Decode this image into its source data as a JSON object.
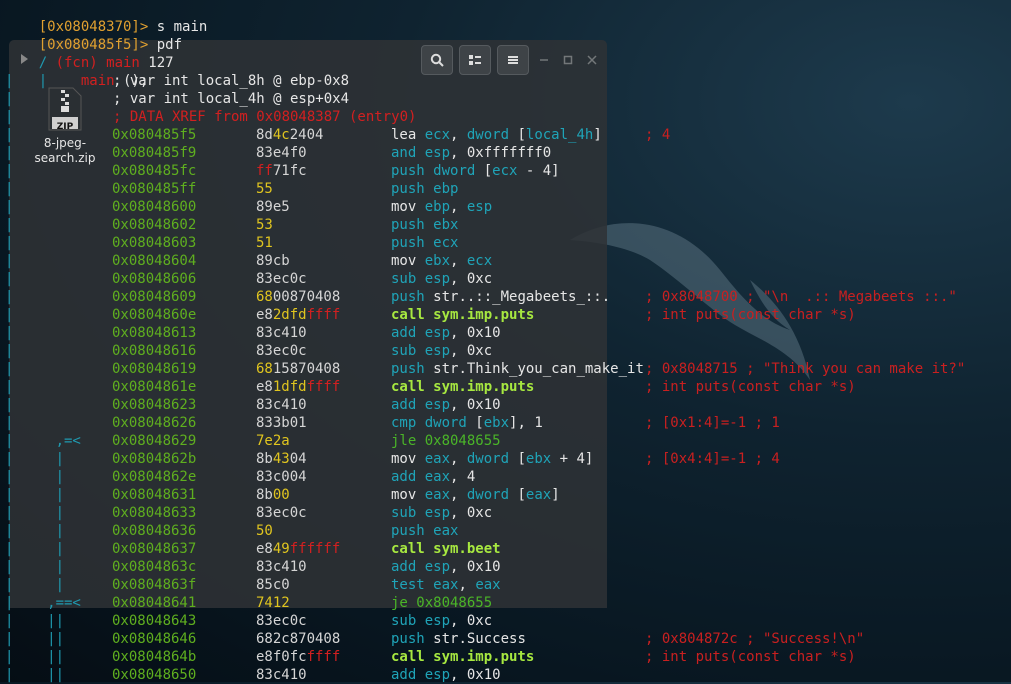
{
  "prompt": [
    {
      "addr": "[0x08048370]>",
      "cmd": " s main"
    },
    {
      "addr": "[0x080485f5]>",
      "cmd": " pdf"
    }
  ],
  "func_header": {
    "prefix": "/ ",
    "fcn": "(fcn) main",
    "size": " 127"
  },
  "func_sig": {
    "name": "main",
    "rest": " ();"
  },
  "vars": [
    "; var int local_8h @ ebp-0x8",
    "; var int local_4h @ esp+0x4"
  ],
  "xref": "; DATA XREF from 0x08048387 (entry0)",
  "desktop_icon": {
    "label_line1": "8-jpeg-",
    "label_line2": "search.zip",
    "badge": "ZIP"
  },
  "colors": {
    "address": "#5faf1f",
    "comment": "#c92020",
    "flow": "#1f9ab0",
    "prompt": "#e0a030"
  },
  "asm": [
    {
      "flow": "| ",
      "addr": "0x080485f5",
      "b": [
        [
          "8d",
          "n"
        ],
        [
          "4c",
          "y"
        ],
        [
          "24",
          "n"
        ],
        [
          "04",
          "n"
        ]
      ],
      "ins": [
        [
          "lea ",
          "w"
        ],
        [
          "ecx",
          "c"
        ],
        [
          ", ",
          "w"
        ],
        [
          "dword ",
          "c"
        ],
        [
          "[",
          "w"
        ],
        [
          "local_4h",
          "c"
        ],
        [
          "]",
          "w"
        ]
      ],
      "cm": "; 4"
    },
    {
      "flow": "| ",
      "addr": "0x080485f9",
      "b": [
        [
          "83e4f0",
          "n"
        ]
      ],
      "ins": [
        [
          "and ",
          "c"
        ],
        [
          "esp",
          "c"
        ],
        [
          ", ",
          "w"
        ],
        [
          "0xfffffff0",
          "w"
        ]
      ],
      "cm": ""
    },
    {
      "flow": "| ",
      "addr": "0x080485fc",
      "b": [
        [
          "ff",
          "r"
        ],
        [
          "71fc",
          "n"
        ]
      ],
      "ins": [
        [
          "push ",
          "c"
        ],
        [
          "dword ",
          "c"
        ],
        [
          "[",
          "w"
        ],
        [
          "ecx",
          "c"
        ],
        [
          " - 4]",
          "w"
        ]
      ],
      "cm": ""
    },
    {
      "flow": "| ",
      "addr": "0x080485ff",
      "b": [
        [
          "55",
          "y"
        ]
      ],
      "ins": [
        [
          "push ",
          "c"
        ],
        [
          "ebp",
          "c"
        ]
      ],
      "cm": ""
    },
    {
      "flow": "| ",
      "addr": "0x08048600",
      "b": [
        [
          "89e5",
          "n"
        ]
      ],
      "ins": [
        [
          "mov ",
          "w"
        ],
        [
          "ebp",
          "c"
        ],
        [
          ", ",
          "w"
        ],
        [
          "esp",
          "c"
        ]
      ],
      "cm": ""
    },
    {
      "flow": "| ",
      "addr": "0x08048602",
      "b": [
        [
          "53",
          "y"
        ]
      ],
      "ins": [
        [
          "push ",
          "c"
        ],
        [
          "ebx",
          "c"
        ]
      ],
      "cm": ""
    },
    {
      "flow": "| ",
      "addr": "0x08048603",
      "b": [
        [
          "51",
          "y"
        ]
      ],
      "ins": [
        [
          "push ",
          "c"
        ],
        [
          "ecx",
          "c"
        ]
      ],
      "cm": ""
    },
    {
      "flow": "| ",
      "addr": "0x08048604",
      "b": [
        [
          "89cb",
          "n"
        ]
      ],
      "ins": [
        [
          "mov ",
          "w"
        ],
        [
          "ebx",
          "c"
        ],
        [
          ", ",
          "w"
        ],
        [
          "ecx",
          "c"
        ]
      ],
      "cm": ""
    },
    {
      "flow": "| ",
      "addr": "0x08048606",
      "b": [
        [
          "83ec0c",
          "n"
        ]
      ],
      "ins": [
        [
          "sub ",
          "c"
        ],
        [
          "esp",
          "c"
        ],
        [
          ", 0xc",
          "w"
        ]
      ],
      "cm": ""
    },
    {
      "flow": "| ",
      "addr": "0x08048609",
      "b": [
        [
          "68",
          "y"
        ],
        [
          "00",
          "n"
        ],
        [
          "870408",
          "n"
        ]
      ],
      "ins": [
        [
          "push ",
          "c"
        ],
        [
          "str..::_Megabeets_::.",
          "w"
        ]
      ],
      "cm": "; 0x8048700 ; \"\\n  .:: Megabeets ::.\""
    },
    {
      "flow": "| ",
      "addr": "0x0804860e",
      "b": [
        [
          "e8",
          "n"
        ],
        [
          "2dfd",
          "y"
        ],
        [
          "ffff",
          "r"
        ]
      ],
      "ins": [
        [
          "call sym.imp.puts",
          "k"
        ]
      ],
      "cm": "; int puts(const char *s)"
    },
    {
      "flow": "| ",
      "addr": "0x08048613",
      "b": [
        [
          "83c410",
          "n"
        ]
      ],
      "ins": [
        [
          "add ",
          "c"
        ],
        [
          "esp",
          "c"
        ],
        [
          ", 0x10",
          "w"
        ]
      ],
      "cm": ""
    },
    {
      "flow": "| ",
      "addr": "0x08048616",
      "b": [
        [
          "83ec0c",
          "n"
        ]
      ],
      "ins": [
        [
          "sub ",
          "c"
        ],
        [
          "esp",
          "c"
        ],
        [
          ", 0xc",
          "w"
        ]
      ],
      "cm": ""
    },
    {
      "flow": "| ",
      "addr": "0x08048619",
      "b": [
        [
          "68",
          "y"
        ],
        [
          "15870408",
          "n"
        ]
      ],
      "ins": [
        [
          "push ",
          "c"
        ],
        [
          "str.Think_you_can_make_it",
          "w"
        ]
      ],
      "cm": "; 0x8048715 ; \"Think you can make it?\""
    },
    {
      "flow": "| ",
      "addr": "0x0804861e",
      "b": [
        [
          "e8",
          "n"
        ],
        [
          "1dfd",
          "y"
        ],
        [
          "ffff",
          "r"
        ]
      ],
      "ins": [
        [
          "call sym.imp.puts",
          "k"
        ]
      ],
      "cm": "; int puts(const char *s)"
    },
    {
      "flow": "| ",
      "addr": "0x08048623",
      "b": [
        [
          "83c410",
          "n"
        ]
      ],
      "ins": [
        [
          "add ",
          "c"
        ],
        [
          "esp",
          "c"
        ],
        [
          ", 0x10",
          "w"
        ]
      ],
      "cm": ""
    },
    {
      "flow": "| ",
      "addr": "0x08048626",
      "b": [
        [
          "833b01",
          "n"
        ]
      ],
      "ins": [
        [
          "cmp ",
          "c"
        ],
        [
          "dword ",
          "c"
        ],
        [
          "[",
          "w"
        ],
        [
          "ebx",
          "c"
        ],
        [
          "], 1",
          "w"
        ]
      ],
      "cm": "; [0x1:4]=-1 ; 1"
    },
    {
      "flow": "|     ,=< ",
      "addr": "0x08048629",
      "b": [
        [
          "7e2a",
          "y"
        ]
      ],
      "ins": [
        [
          "jle 0x8048655",
          "g"
        ]
      ],
      "cm": ""
    },
    {
      "flow": "|     |   ",
      "addr": "0x0804862b",
      "b": [
        [
          "8b",
          "n"
        ],
        [
          "43",
          "y"
        ],
        [
          "04",
          "n"
        ]
      ],
      "ins": [
        [
          "mov ",
          "w"
        ],
        [
          "eax",
          "c"
        ],
        [
          ", ",
          "w"
        ],
        [
          "dword ",
          "c"
        ],
        [
          "[",
          "w"
        ],
        [
          "ebx",
          "c"
        ],
        [
          " + 4]",
          "w"
        ]
      ],
      "cm": "; [0x4:4]=-1 ; 4"
    },
    {
      "flow": "|     |   ",
      "addr": "0x0804862e",
      "b": [
        [
          "83c004",
          "n"
        ]
      ],
      "ins": [
        [
          "add ",
          "c"
        ],
        [
          "eax",
          "c"
        ],
        [
          ", 4",
          "w"
        ]
      ],
      "cm": ""
    },
    {
      "flow": "|     |   ",
      "addr": "0x08048631",
      "b": [
        [
          "8b",
          "n"
        ],
        [
          "00",
          "y"
        ]
      ],
      "ins": [
        [
          "mov ",
          "w"
        ],
        [
          "eax",
          "c"
        ],
        [
          ", ",
          "w"
        ],
        [
          "dword ",
          "c"
        ],
        [
          "[",
          "w"
        ],
        [
          "eax",
          "c"
        ],
        [
          "]",
          "w"
        ]
      ],
      "cm": ""
    },
    {
      "flow": "|     |   ",
      "addr": "0x08048633",
      "b": [
        [
          "83ec0c",
          "n"
        ]
      ],
      "ins": [
        [
          "sub ",
          "c"
        ],
        [
          "esp",
          "c"
        ],
        [
          ", 0xc",
          "w"
        ]
      ],
      "cm": ""
    },
    {
      "flow": "|     |   ",
      "addr": "0x08048636",
      "b": [
        [
          "50",
          "y"
        ]
      ],
      "ins": [
        [
          "push ",
          "c"
        ],
        [
          "eax",
          "c"
        ]
      ],
      "cm": ""
    },
    {
      "flow": "|     |   ",
      "addr": "0x08048637",
      "b": [
        [
          "e8",
          "n"
        ],
        [
          "49",
          "y"
        ],
        [
          "ffffff",
          "r"
        ]
      ],
      "ins": [
        [
          "call sym.beet",
          "k"
        ]
      ],
      "cm": ""
    },
    {
      "flow": "|     |   ",
      "addr": "0x0804863c",
      "b": [
        [
          "83c410",
          "n"
        ]
      ],
      "ins": [
        [
          "add ",
          "c"
        ],
        [
          "esp",
          "c"
        ],
        [
          ", 0x10",
          "w"
        ]
      ],
      "cm": ""
    },
    {
      "flow": "|     |   ",
      "addr": "0x0804863f",
      "b": [
        [
          "85c0",
          "n"
        ]
      ],
      "ins": [
        [
          "test ",
          "c"
        ],
        [
          "eax",
          "c"
        ],
        [
          ", ",
          "w"
        ],
        [
          "eax",
          "c"
        ]
      ],
      "cm": ""
    },
    {
      "flow": "|    ,==< ",
      "addr": "0x08048641",
      "b": [
        [
          "7412",
          "y"
        ]
      ],
      "ins": [
        [
          "je 0x8048655",
          "g"
        ]
      ],
      "cm": ""
    },
    {
      "flow": "|    ||   ",
      "addr": "0x08048643",
      "b": [
        [
          "83ec0c",
          "n"
        ]
      ],
      "ins": [
        [
          "sub ",
          "c"
        ],
        [
          "esp",
          "c"
        ],
        [
          ", 0xc",
          "w"
        ]
      ],
      "cm": ""
    },
    {
      "flow": "|    ||   ",
      "addr": "0x08048646",
      "b": [
        [
          "682c870408",
          "n"
        ]
      ],
      "ins": [
        [
          "push ",
          "c"
        ],
        [
          "str.Success",
          "w"
        ]
      ],
      "cm": "; 0x804872c ; \"Success!\\n\""
    },
    {
      "flow": "|    ||   ",
      "addr": "0x0804864b",
      "b": [
        [
          "e8f0fc",
          "n"
        ],
        [
          "ffff",
          "r"
        ]
      ],
      "ins": [
        [
          "call sym.imp.puts",
          "k"
        ]
      ],
      "cm": "; int puts(const char *s)"
    },
    {
      "flow": "|    ||   ",
      "addr": "0x08048650",
      "b": [
        [
          "83c410",
          "n"
        ]
      ],
      "ins": [
        [
          "add ",
          "c"
        ],
        [
          "esp",
          "c"
        ],
        [
          ", 0x10",
          "w"
        ]
      ],
      "cm": ""
    }
  ]
}
